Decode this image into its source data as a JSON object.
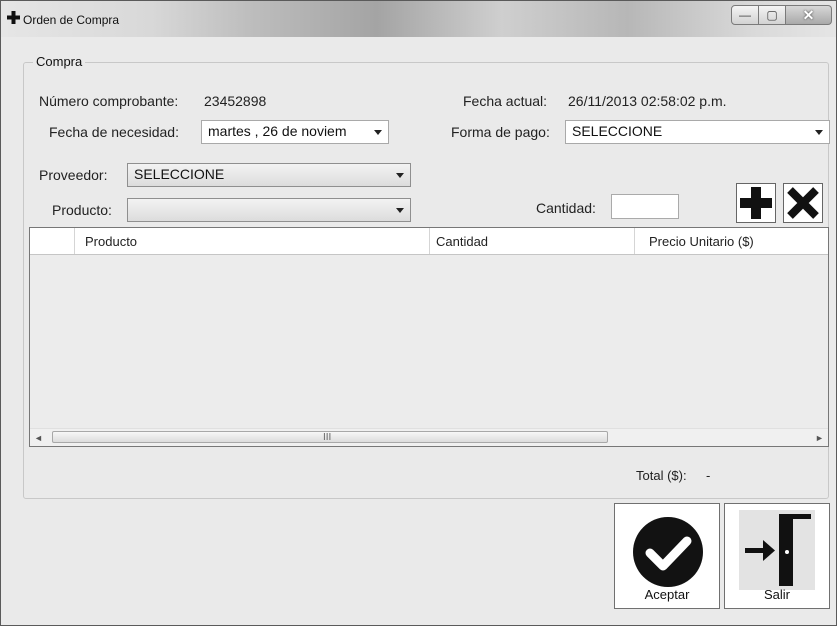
{
  "window": {
    "title": "Orden de Compra",
    "controls": {
      "minimize": "—",
      "maximize": "▢",
      "close": "✕"
    }
  },
  "group": {
    "title": "Compra",
    "numero_label": "Número comprobante:",
    "numero_value": "23452898",
    "fecha_actual_label": "Fecha actual:",
    "fecha_actual_value": "26/11/2013 02:58:02 p.m.",
    "fecha_necesidad_label": "Fecha de necesidad:",
    "fecha_necesidad_value": "martes  , 26 de noviem",
    "forma_pago_label": "Forma de pago:",
    "forma_pago_value": "SELECCIONE",
    "proveedor_label": "Proveedor:",
    "proveedor_value": "SELECCIONE",
    "producto_label": "Producto:",
    "producto_value": "",
    "cantidad_label": "Cantidad:",
    "cantidad_value": "",
    "add_icon": "plus-icon",
    "remove_icon": "x-icon"
  },
  "grid": {
    "columns": [
      "",
      "Producto",
      "Cantidad",
      "Precio Unitario ($)"
    ],
    "rows": [],
    "scroll_left": "◄",
    "scroll_right": "►",
    "scroll_grip": "III"
  },
  "total": {
    "label": "Total ($):",
    "value": "-"
  },
  "buttons": {
    "aceptar": {
      "label": "Aceptar",
      "icon": "check-circle-icon"
    },
    "salir": {
      "label": "Salir",
      "icon": "exit-door-icon"
    }
  }
}
